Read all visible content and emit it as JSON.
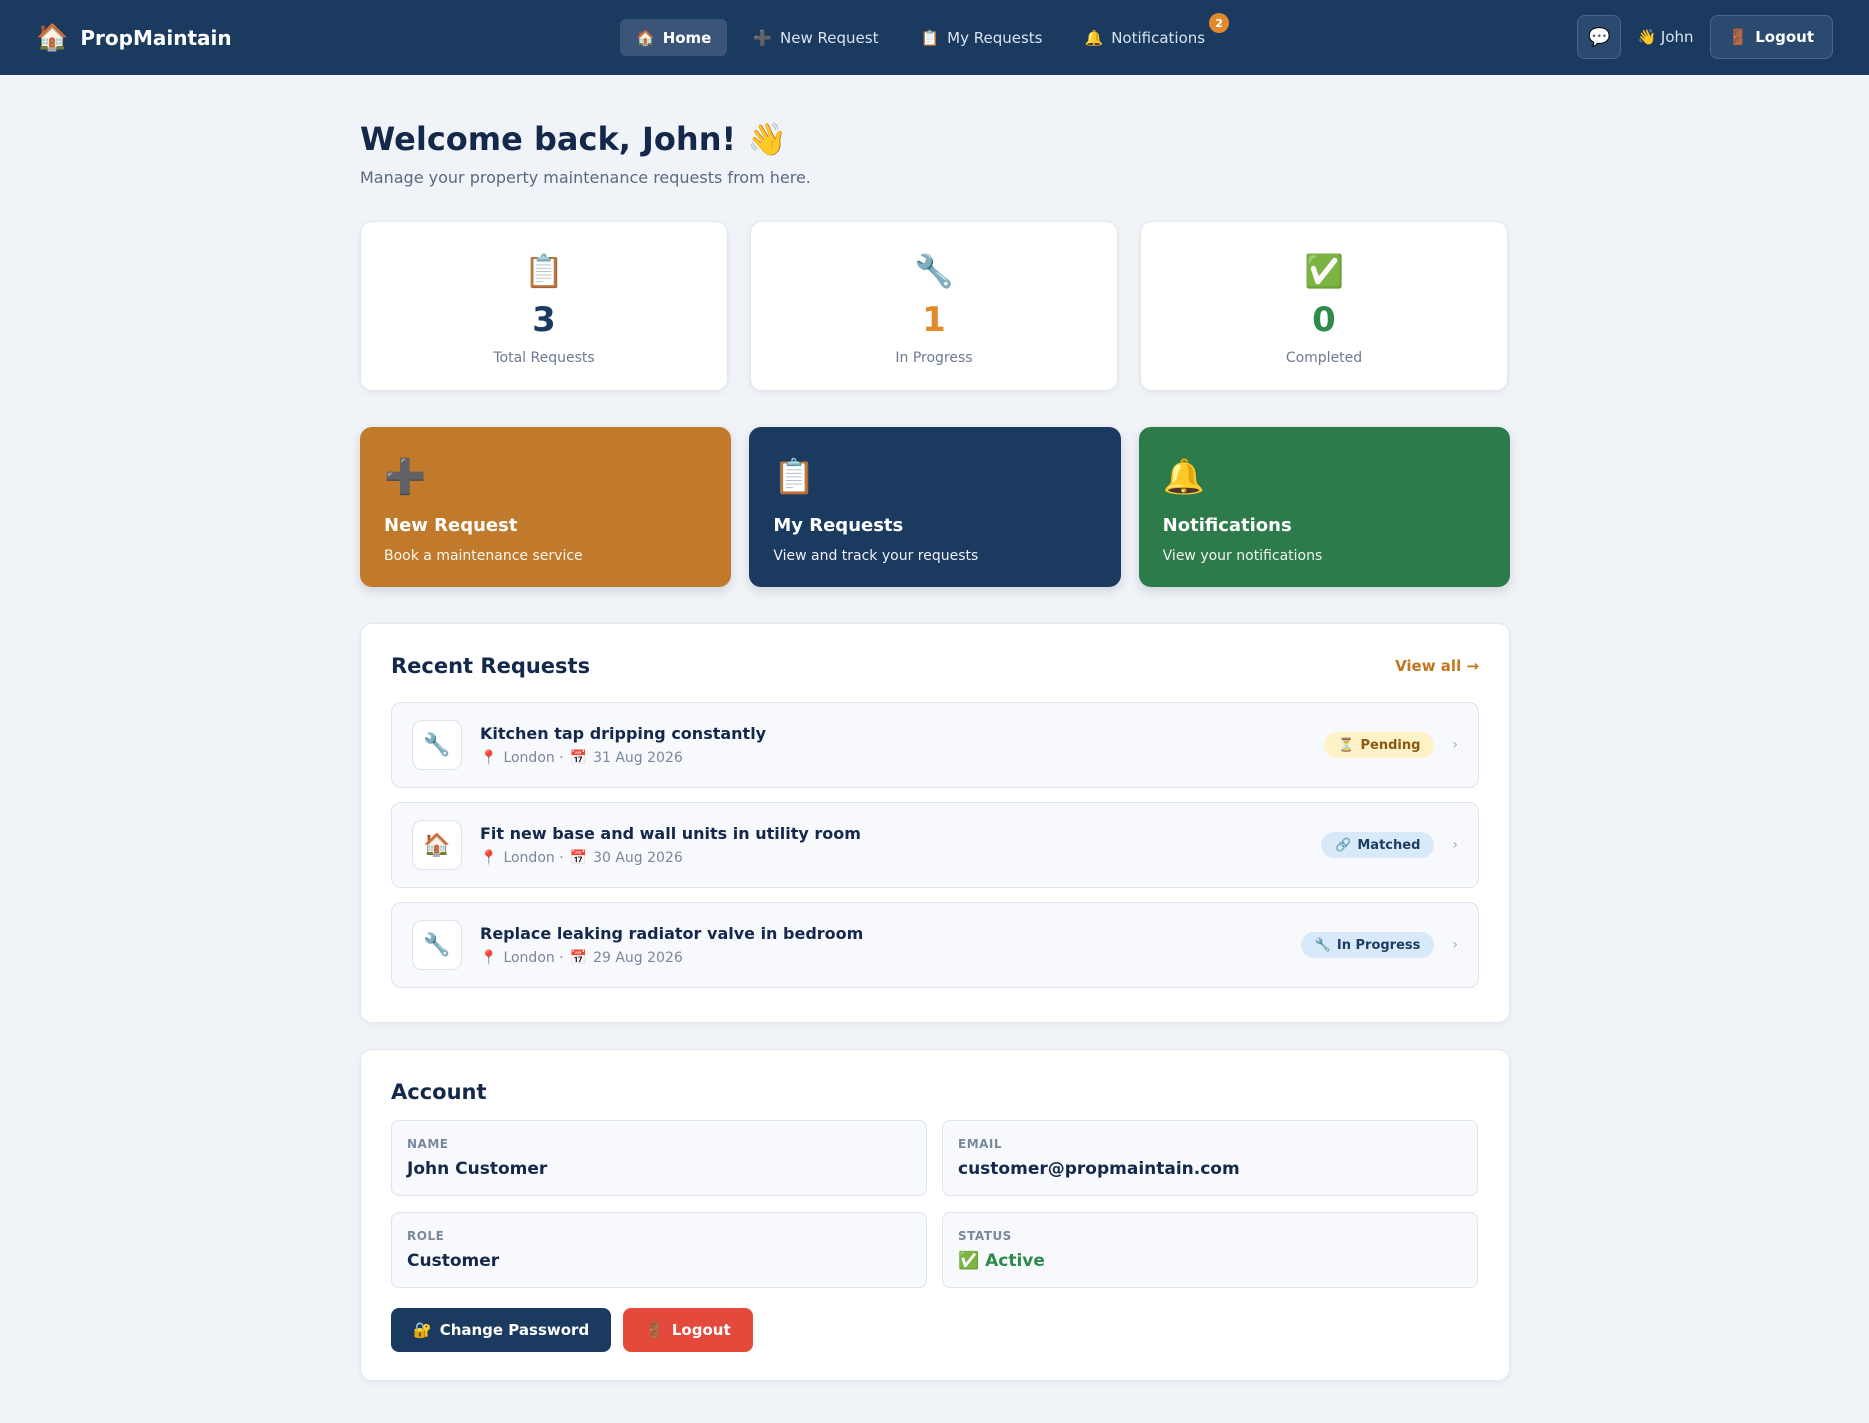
{
  "nav": {
    "brand": "PropMaintain",
    "brand_icon": "🏠",
    "links": [
      {
        "icon": "🏠",
        "label": "Home"
      },
      {
        "icon": "➕",
        "label": "New Request"
      },
      {
        "icon": "📋",
        "label": "My Requests"
      },
      {
        "icon": "🔔",
        "label": "Notifications"
      }
    ],
    "notification_count": "2",
    "chat_icon": "💬",
    "user": "👋 John",
    "logout_icon": "🚪",
    "logout": "Logout"
  },
  "welcome": {
    "title": "Welcome back, John! 👋",
    "subtitle": "Manage your property maintenance requests from here."
  },
  "stats": [
    {
      "icon": "📋",
      "value": "3",
      "label": "Total Requests",
      "color": "#1a3a60"
    },
    {
      "icon": "🔧",
      "value": "1",
      "label": "In Progress",
      "color": "#e08a2c"
    },
    {
      "icon": "✅",
      "value": "0",
      "label": "Completed",
      "color": "#2f8a4c"
    }
  ],
  "actions": [
    {
      "icon": "➕",
      "title": "New Request",
      "desc": "Book a maintenance service",
      "color": "#c17a2c"
    },
    {
      "icon": "📋",
      "title": "My Requests",
      "desc": "View and track your requests",
      "color": "#1a3a60"
    },
    {
      "icon": "🔔",
      "title": "Notifications",
      "desc": "View your notifications",
      "color": "#2d7a4a"
    }
  ],
  "recent": {
    "title": "Recent Requests",
    "view_all": "View all →",
    "items": [
      {
        "icon": "🔧",
        "title": "Kitchen tap dripping constantly",
        "location": "London ·",
        "date": "31 Aug 2026",
        "status_icon": "⏳",
        "status": "Pending"
      },
      {
        "icon": "🏠",
        "title": "Fit new base and wall units in utility room",
        "location": "London ·",
        "date": "30 Aug 2026",
        "status_icon": "🔗",
        "status": "Matched"
      },
      {
        "icon": "🔧",
        "title": "Replace leaking radiator valve in bedroom",
        "location": "London ·",
        "date": "29 Aug 2026",
        "status_icon": "🔧",
        "status": "In Progress"
      }
    ]
  },
  "account": {
    "title": "Account",
    "name_label": "NAME",
    "name": "John Customer",
    "email_label": "EMAIL",
    "email": "customer@propmaintain.com",
    "role_label": "ROLE",
    "role": "Customer",
    "status_label": "STATUS",
    "status_icon": "✅",
    "status": "Active",
    "change_password_icon": "🔐",
    "change_password": "Change Password",
    "logout_icon": "🚪",
    "logout": "Logout"
  }
}
